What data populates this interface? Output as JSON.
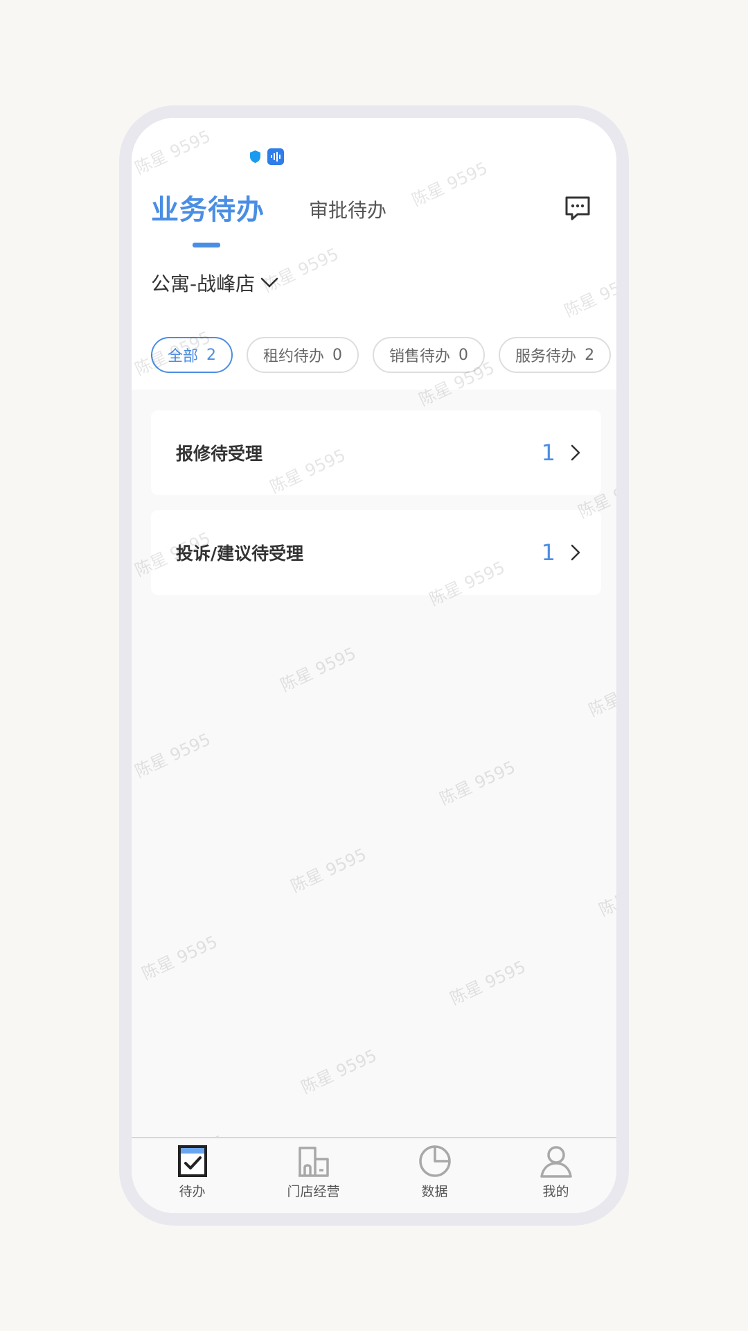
{
  "header": {
    "tabs": [
      {
        "label": "业务待办",
        "active": true
      },
      {
        "label": "审批待办",
        "active": false
      }
    ],
    "message_icon": "chat-bubble-icon"
  },
  "store": {
    "name": "公寓-战峰店",
    "icon": "chevron-down-icon"
  },
  "filters": [
    {
      "label": "全部",
      "count": "2",
      "active": true
    },
    {
      "label": "租约待办",
      "count": "0",
      "active": false
    },
    {
      "label": "销售待办",
      "count": "0",
      "active": false
    },
    {
      "label": "服务待办",
      "count": "2",
      "active": false
    }
  ],
  "tasks": [
    {
      "label": "报修待受理",
      "count": "1"
    },
    {
      "label": "投诉/建议待受理",
      "count": "1"
    }
  ],
  "bottom_nav": [
    {
      "label": "待办",
      "icon": "todo-check-icon",
      "active": true
    },
    {
      "label": "门店经营",
      "icon": "building-icon",
      "active": false
    },
    {
      "label": "数据",
      "icon": "pie-chart-icon",
      "active": false
    },
    {
      "label": "我的",
      "icon": "person-icon",
      "active": false
    }
  ],
  "watermark": "陈星 9595",
  "colors": {
    "accent": "#4a8ee4",
    "text": "#333333",
    "frame": "#e9e8ee"
  }
}
